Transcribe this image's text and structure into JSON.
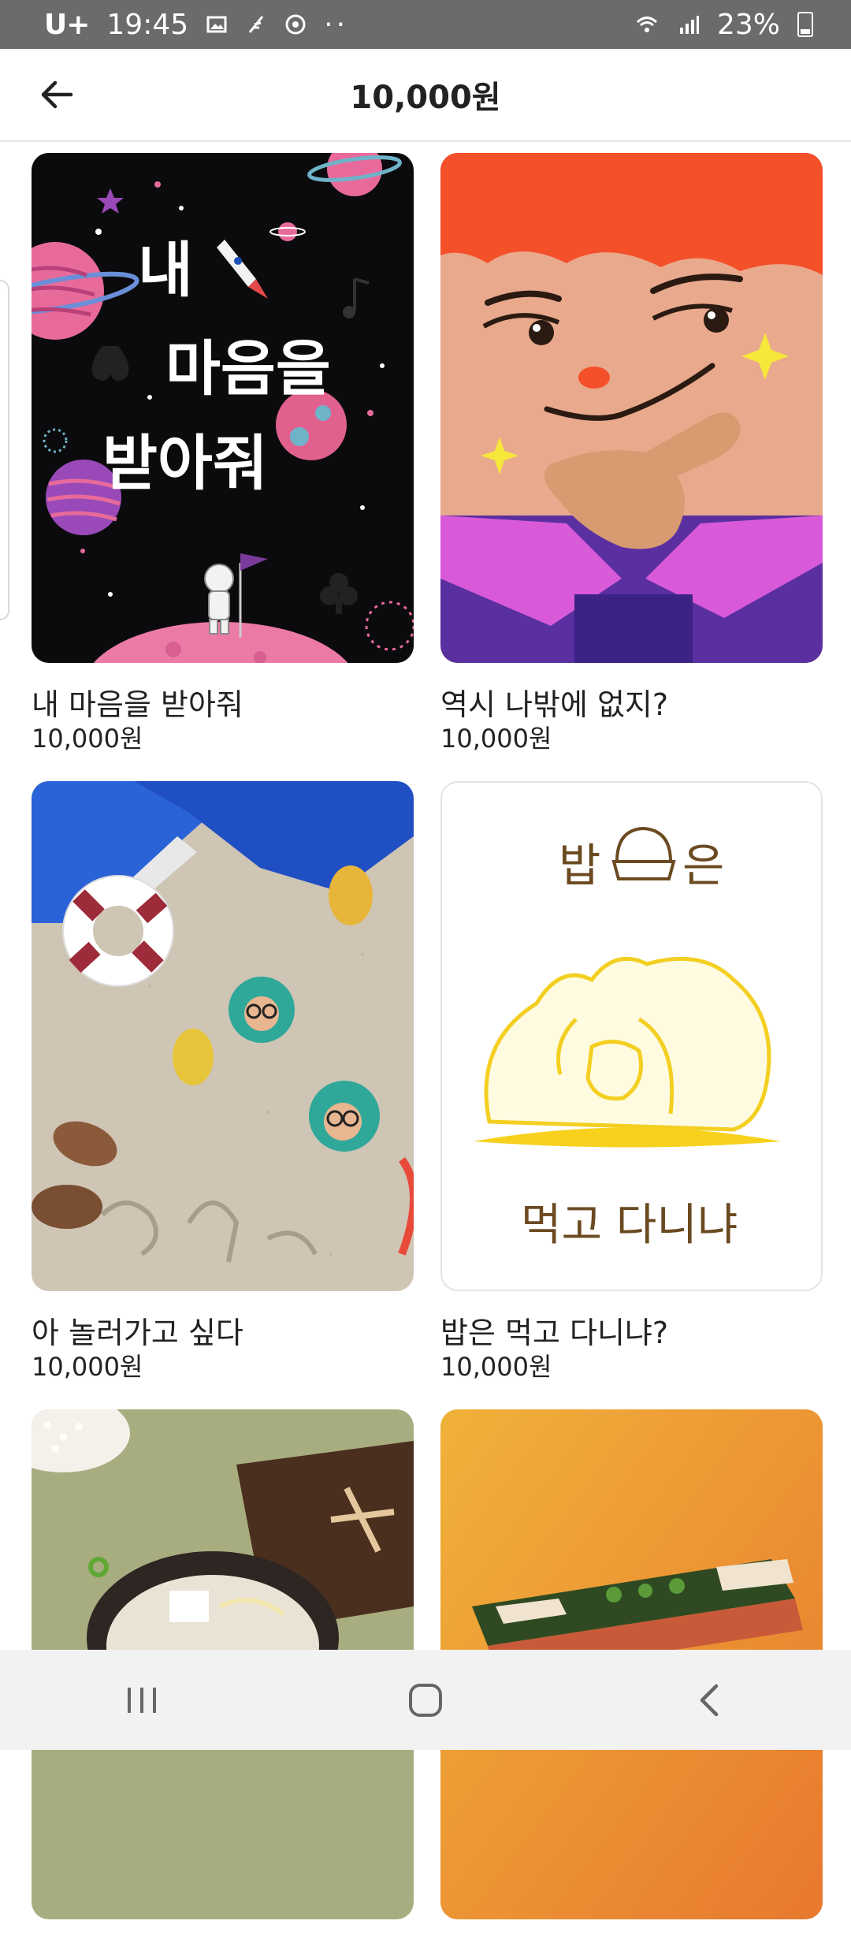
{
  "status_bar": {
    "carrier": "U+",
    "time": "19:45",
    "battery": "23%"
  },
  "header": {
    "title": "10,000원",
    "back_icon": "arrow-left-icon"
  },
  "cards": [
    {
      "title": "내 마음을 받아줘",
      "price": "10,000원",
      "art_text": [
        "내",
        "마음을",
        "받아줘"
      ]
    },
    {
      "title": "역시 나밖에 없지?",
      "price": "10,000원"
    },
    {
      "title": "아 놀러가고 싶다",
      "price": "10,000원"
    },
    {
      "title": "밥은 먹고 다니냐?",
      "price": "10,000원",
      "art_text": [
        "밥",
        "은",
        "먹고 다니냐"
      ]
    },
    {
      "title": "",
      "price": ""
    },
    {
      "title": "",
      "price": ""
    }
  ],
  "nav": {
    "recents_icon": "recents-icon",
    "home_icon": "home-icon",
    "back_icon": "chevron-left-icon"
  },
  "colors": {
    "status_bar_bg": "#6b6b6b",
    "nav_bg": "#f2f2f2",
    "divider": "#e5e5e5"
  }
}
